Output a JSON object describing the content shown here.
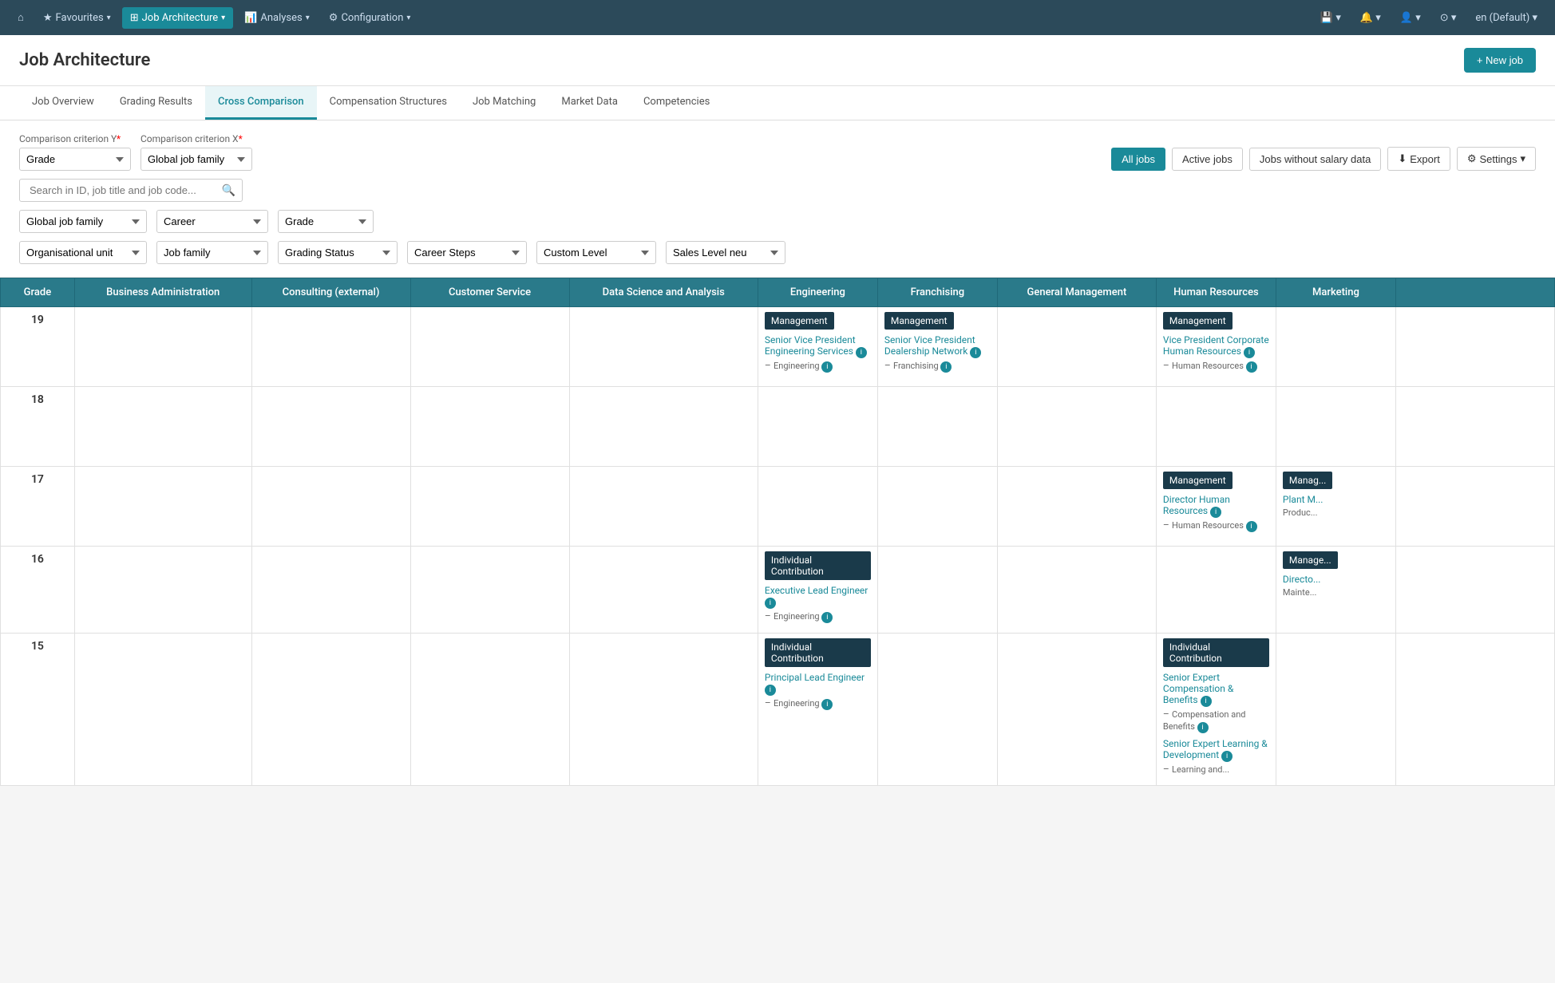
{
  "nav": {
    "home_icon": "⌂",
    "items": [
      {
        "label": "Favourites",
        "has_dropdown": true,
        "active": false
      },
      {
        "label": "Job Architecture",
        "has_dropdown": true,
        "active": true
      },
      {
        "label": "Analyses",
        "has_dropdown": true,
        "active": false
      },
      {
        "label": "Configuration",
        "has_dropdown": true,
        "active": false
      }
    ],
    "right_icons": [
      "💾",
      "🔔",
      "👤",
      "⚙",
      "en (Default)"
    ]
  },
  "page": {
    "title": "Job Architecture",
    "new_job_label": "+ New job"
  },
  "tabs": [
    {
      "label": "Job Overview",
      "active": false
    },
    {
      "label": "Grading Results",
      "active": false
    },
    {
      "label": "Cross Comparison",
      "active": true
    },
    {
      "label": "Compensation Structures",
      "active": false
    },
    {
      "label": "Job Matching",
      "active": false
    },
    {
      "label": "Market Data",
      "active": false
    },
    {
      "label": "Competencies",
      "active": false
    }
  ],
  "filters": {
    "criterion_y_label": "Comparison criterion Y",
    "criterion_x_label": "Comparison criterion X",
    "required_mark": "*",
    "criterion_y_value": "Grade",
    "criterion_x_value": "Global job family",
    "search_placeholder": "Search in ID, job title and job code...",
    "dropdowns": [
      {
        "name": "global-job-family",
        "value": "Global job family"
      },
      {
        "name": "career",
        "value": "Career"
      },
      {
        "name": "grade",
        "value": "Grade"
      },
      {
        "name": "organisational-unit",
        "value": "Organisational unit"
      },
      {
        "name": "job-family",
        "value": "Job family"
      },
      {
        "name": "grading-status",
        "value": "Grading Status"
      },
      {
        "name": "career-steps",
        "value": "Career Steps"
      },
      {
        "name": "custom-level",
        "value": "Custom Level"
      },
      {
        "name": "sales-level",
        "value": "Sales Level neu"
      }
    ],
    "view_buttons": [
      {
        "label": "All jobs",
        "active": true
      },
      {
        "label": "Active jobs",
        "active": false
      },
      {
        "label": "Jobs without salary data",
        "active": false
      }
    ],
    "export_label": "Export",
    "settings_label": "Settings"
  },
  "grid": {
    "columns": [
      {
        "label": "Grade",
        "type": "grade"
      },
      {
        "label": "Business Administration",
        "type": "data"
      },
      {
        "label": "Consulting (external)",
        "type": "data"
      },
      {
        "label": "Customer Service",
        "type": "data"
      },
      {
        "label": "Data Science and Analysis",
        "type": "data"
      },
      {
        "label": "Engineering",
        "type": "data"
      },
      {
        "label": "Franchising",
        "type": "data"
      },
      {
        "label": "General Management",
        "type": "data"
      },
      {
        "label": "Human Resources",
        "type": "data"
      },
      {
        "label": "Marketing",
        "type": "data"
      }
    ],
    "rows": [
      {
        "grade": "19",
        "cells": {
          "Engineering": {
            "category": "Management",
            "jobs": [
              {
                "title": "Senior Vice President Engineering Services",
                "sub": "Engineering"
              }
            ]
          },
          "Franchising": {
            "category": "Management",
            "jobs": [
              {
                "title": "Senior Vice President Dealership Network",
                "sub": "Franchising"
              }
            ]
          },
          "Human Resources": {
            "category": "Management",
            "jobs": [
              {
                "title": "Vice President Corporate Human Resources",
                "sub": "Human Resources"
              }
            ]
          }
        }
      },
      {
        "grade": "18",
        "cells": {}
      },
      {
        "grade": "17",
        "cells": {
          "Human Resources": {
            "category": "Management",
            "jobs": [
              {
                "title": "Director Human Resources",
                "sub": "Human Resources"
              }
            ]
          },
          "Marketing": {
            "category": "Management",
            "jobs": [
              {
                "title": "Plant M...",
                "sub": "Produc..."
              }
            ]
          }
        }
      },
      {
        "grade": "16",
        "cells": {
          "Engineering": {
            "category": "Individual Contribution",
            "jobs": [
              {
                "title": "Executive Lead Engineer",
                "sub": "Engineering"
              }
            ]
          },
          "Marketing": {
            "category": "Management",
            "jobs": [
              {
                "title": "Directo...",
                "sub": "Mainte..."
              }
            ]
          }
        }
      },
      {
        "grade": "15",
        "cells": {
          "Engineering": {
            "category": "Individual Contribution",
            "jobs": [
              {
                "title": "Principal Lead Engineer",
                "sub": "Engineering"
              }
            ]
          },
          "Human Resources": {
            "category": "Individual Contribution",
            "jobs": [
              {
                "title": "Senior Expert Compensation & Benefits",
                "sub": "Compensation and Benefits"
              },
              {
                "title": "Senior Expert Learning & Development",
                "sub": "Learning and..."
              }
            ]
          }
        }
      }
    ]
  }
}
